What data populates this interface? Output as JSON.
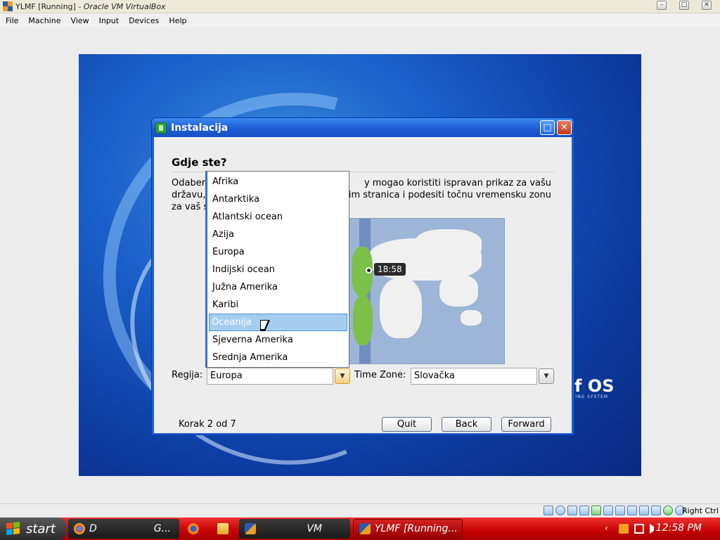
{
  "vbox": {
    "title_prefix": "YLMF [Running] - ",
    "title_app": "Oracle VM VirtualBox",
    "menu": [
      "File",
      "Machine",
      "View",
      "Input",
      "Devices",
      "Help"
    ],
    "min_glyph": "–",
    "max_glyph": "□",
    "close_glyph": "✕",
    "right_ctrl": "Right Ctrl"
  },
  "guest": {
    "logo_text": "f OS",
    "logo_sub": "ATING SYSTEM"
  },
  "dialog": {
    "title": "Instalacija",
    "heading": "Gdje ste?",
    "description": "Odaberite lokaciju na karti kako bi sustav mogao koristiti ispravan prikaz za vašu državu, pronaći najbliže preuzimanje sa web stranica i podesiti točnu vremensku zonu za vaš sat.",
    "desc_line1_a": "Odaberi",
    "desc_line1_b": "y mogao koristiti ispravan prikaz za vašu",
    "desc_line2_a": "državu,",
    "desc_line2_b": "im stranica i podesiti točnu vremensku zonu",
    "desc_line3_a": "za vaš s",
    "map_time": "18:58",
    "region_label": "Regija:",
    "region_value": "Europa",
    "timezone_label": "Time Zone:",
    "timezone_value": "Slovačka",
    "step_text": "Korak 2 od 7",
    "quit_label": "Quit",
    "back_label": "Back",
    "forward_label": "Forward",
    "arrow_glyph": "▼",
    "max_glyph": "□",
    "close_glyph": "✕"
  },
  "dropdown": {
    "items": [
      "Afrika",
      "Antarktika",
      "Atlantski ocean",
      "Azija",
      "Europa",
      "Indijski ocean",
      "Južna Amerika",
      "Karibi",
      "Oceanija",
      "Sjeverna Amerika",
      "Srednja Amerika"
    ],
    "selected_index": 8
  },
  "taskbar": {
    "start_label": "start",
    "tasks": [
      "D",
      "G...",
      "VM",
      "YLMF [Running..."
    ],
    "tray_arrow": "‹",
    "clock": "12:58 PM"
  },
  "colors": {
    "dialog_title": "#1c5ad4",
    "taskbar": "#c40000",
    "selection": "#a5cdf0"
  }
}
